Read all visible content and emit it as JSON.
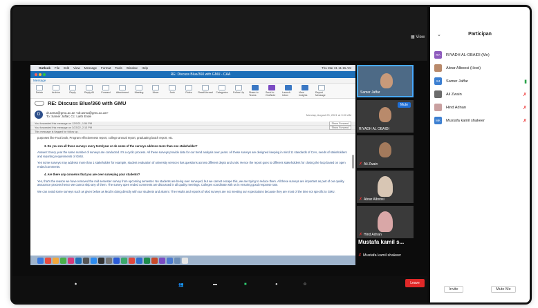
{
  "zoom": {
    "view_label": "View",
    "participants_title": "Participan",
    "leave_label": "Leave",
    "invite_label": "Invite",
    "mute_all_label": "Mute Me",
    "active_speaker_big": "Mustafa kamil s...",
    "active_speaker_small": "Mustafa kamil shakeer",
    "tile_mute_label": "Mute"
  },
  "tiles": [
    {
      "name": "Samer Jaffar"
    },
    {
      "name": "RIYADH AL OBAIDI"
    },
    {
      "name": "Ali Zwain"
    },
    {
      "name": "Abrar Alboosi"
    },
    {
      "name": "Hind Adnan"
    }
  ],
  "participants": [
    {
      "initials": "RA",
      "name": "RIYADH AL-OBAIDI (Me)",
      "color": "#8e5bbd",
      "status": ""
    },
    {
      "initials": "",
      "name": "Abrar Alboosi (Host)",
      "color": "#b98a6b",
      "status": ""
    },
    {
      "initials": "SJ",
      "name": "Samer Jaffar",
      "color": "#3c7fd1",
      "status": "cam"
    },
    {
      "initials": "",
      "name": "Ali Zwain",
      "color": "#6b6b6b",
      "status": "muted"
    },
    {
      "initials": "",
      "name": "Hind Adnan",
      "color": "#c9a0a0",
      "status": "muted"
    },
    {
      "initials": "MK",
      "name": "Mustafa kamil shakeer",
      "color": "#3c7fd1",
      "status": "muted"
    }
  ],
  "outlook": {
    "menubar": [
      "Outlook",
      "File",
      "Edit",
      "View",
      "Message",
      "Format",
      "Tools",
      "Window",
      "Help"
    ],
    "clock": "Thu Mar 31  11:15 AM",
    "window_title": "RE: Discuss Blue/360 with GMU - CAA",
    "tab": "Message",
    "ribbon": [
      "Delete",
      "Archive",
      "Reply",
      "Reply All",
      "Forward",
      "Attachment",
      "Meeting",
      "Move",
      "Junk",
      "Rules",
      "Read/Unread",
      "Categorize",
      "Follow Up",
      "Share to Teams",
      "Send to OneNote",
      "Launch Inbox",
      "View Insights",
      "Report Message"
    ],
    "subject": "RE: Discuss Blue/360 with GMU",
    "sender_initial": "D",
    "sender": "dr.asma@gmu.ac.ae <dr.asma@gmu.ac.ae>",
    "recipients": "To: Samer Jaffar;  Cc: Laith Ende",
    "date": "Monday, August 23, 2021 at 9:00 AM",
    "info1": "You forwarded this message on 12/9/21, 1:54 PM",
    "info2": "You forwarded this message on 3/23/22, 2:13 PM",
    "info3": "This message is flagged for follow up.",
    "show_forward": "Show Forward",
    "intro": "purposes like Fact book, Program effectiveness report, college annual report, graduating batch report, etc.",
    "q1": "3.   Do you run all these surveys every term/year or do some of the surveys address more than one stakeholder?",
    "a1": "Answer: Every year the same number of surveys are conducted. It's a cyclic process. All these surveys provide data for our trend analysis over years. All these surveys are designed keeping in mind 11 standards of CAA, needs of stakeholders and reporting requirements of GMU.",
    "a1b": "Yes some surveys may address more than 1 stakeholder for example, student evaluation of university services has questions across different depts and units. Hence the report goes to different stakeholders for closing the loop based on open ended comments.",
    "q2": "4.   Are there any concerns that you are over surveying your students?",
    "a2": "Yes, that's the reason we have removed the mid semester survey from upcoming semester. No students are being over surveyed, but we cannot escape this, we are trying to reduce them. All these surveys are important as part of our quality assurance process hence we cannot skip any of them. The survey open ended comments are discussed in all quality meetings. Colleges coordinate with us in ensuring good response rate.",
    "a2b": "We can avoid some surveys such as given below as Mod is doing directly with our students and alumni. The results and reports of Mod surveys are not meeting our expectations because they are most of the time not specific to GMU."
  }
}
